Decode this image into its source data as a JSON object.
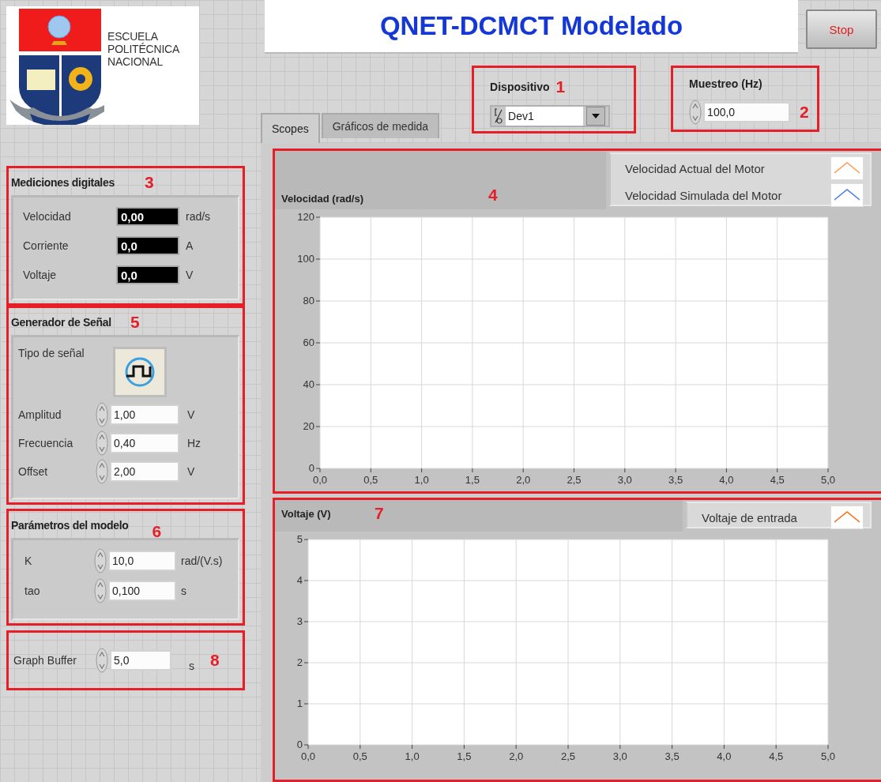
{
  "logo": {
    "lines": [
      "ESCUELA",
      "POLITÉCNICA",
      "NACIONAL"
    ]
  },
  "title": "QNET-DCMCT Modelado",
  "stop_button": "Stop",
  "device": {
    "label": "Dispositivo",
    "value": "Dev1",
    "annotation": "1"
  },
  "sampling": {
    "label": "Muestreo (Hz)",
    "value": "100,0",
    "annotation": "2"
  },
  "tabs": [
    {
      "label": "Scopes",
      "selected": true
    },
    {
      "label": "Gráficos de medida",
      "selected": false
    }
  ],
  "digital_measurements": {
    "title": "Mediciones digitales",
    "annotation": "3",
    "rows": [
      {
        "label": "Velocidad",
        "value": "0,00",
        "unit": "rad/s"
      },
      {
        "label": "Corriente",
        "value": "0,0",
        "unit": "A"
      },
      {
        "label": "Voltaje",
        "value": "0,0",
        "unit": "V"
      }
    ]
  },
  "signal_generator": {
    "title": "Generador de Señal",
    "annotation": "5",
    "type_label": "Tipo de señal",
    "controls": [
      {
        "label": "Amplitud",
        "value": "1,00",
        "unit": "V"
      },
      {
        "label": "Frecuencia",
        "value": "0,40",
        "unit": "Hz"
      },
      {
        "label": "Offset",
        "value": "2,00",
        "unit": "V"
      }
    ]
  },
  "model_parameters": {
    "title": "Parámetros del modelo",
    "annotation": "6",
    "controls": [
      {
        "label": "K",
        "value": "10,0",
        "unit": "rad/(V.s)"
      },
      {
        "label": "tao",
        "value": "0,100",
        "unit": "s"
      }
    ]
  },
  "graph_buffer": {
    "label": "Graph Buffer",
    "value": "5,0",
    "unit": "s",
    "annotation": "8"
  },
  "velocity_chart": {
    "annotation": "4",
    "chart_data": {
      "type": "line",
      "title": "Velocidad (rad/s)",
      "grid": true,
      "ylim": [
        0,
        120
      ],
      "categories": [
        "0,0",
        "0,5",
        "1,0",
        "1,5",
        "2,0",
        "2,5",
        "3,0",
        "3,5",
        "4,0",
        "4,5",
        "5,0"
      ],
      "yticks": [
        0,
        20,
        40,
        60,
        80,
        100,
        120
      ],
      "series": [
        {
          "name": "Velocidad Actual del Motor",
          "color": "#ff9a55",
          "values": [
            null,
            null,
            null,
            null,
            null,
            null,
            null,
            null,
            null,
            null,
            null
          ]
        },
        {
          "name": "Velocidad Simulada del Motor",
          "color": "#4a78f0",
          "values": [
            null,
            null,
            null,
            null,
            null,
            null,
            null,
            null,
            null,
            null,
            null
          ]
        }
      ]
    }
  },
  "voltage_chart": {
    "annotation": "7",
    "chart_data": {
      "type": "line",
      "title": "Voltaje (V)",
      "grid": true,
      "ylim": [
        0,
        5
      ],
      "categories": [
        "0,0",
        "0,5",
        "1,0",
        "1,5",
        "2,0",
        "2,5",
        "3,0",
        "3,5",
        "4,0",
        "4,5",
        "5,0"
      ],
      "yticks": [
        0,
        1,
        2,
        3,
        4,
        5
      ],
      "series": [
        {
          "name": "Voltaje de entrada",
          "color": "#ff6a10",
          "values": [
            null,
            null,
            null,
            null,
            null,
            null,
            null,
            null,
            null,
            null,
            null
          ]
        }
      ]
    }
  }
}
